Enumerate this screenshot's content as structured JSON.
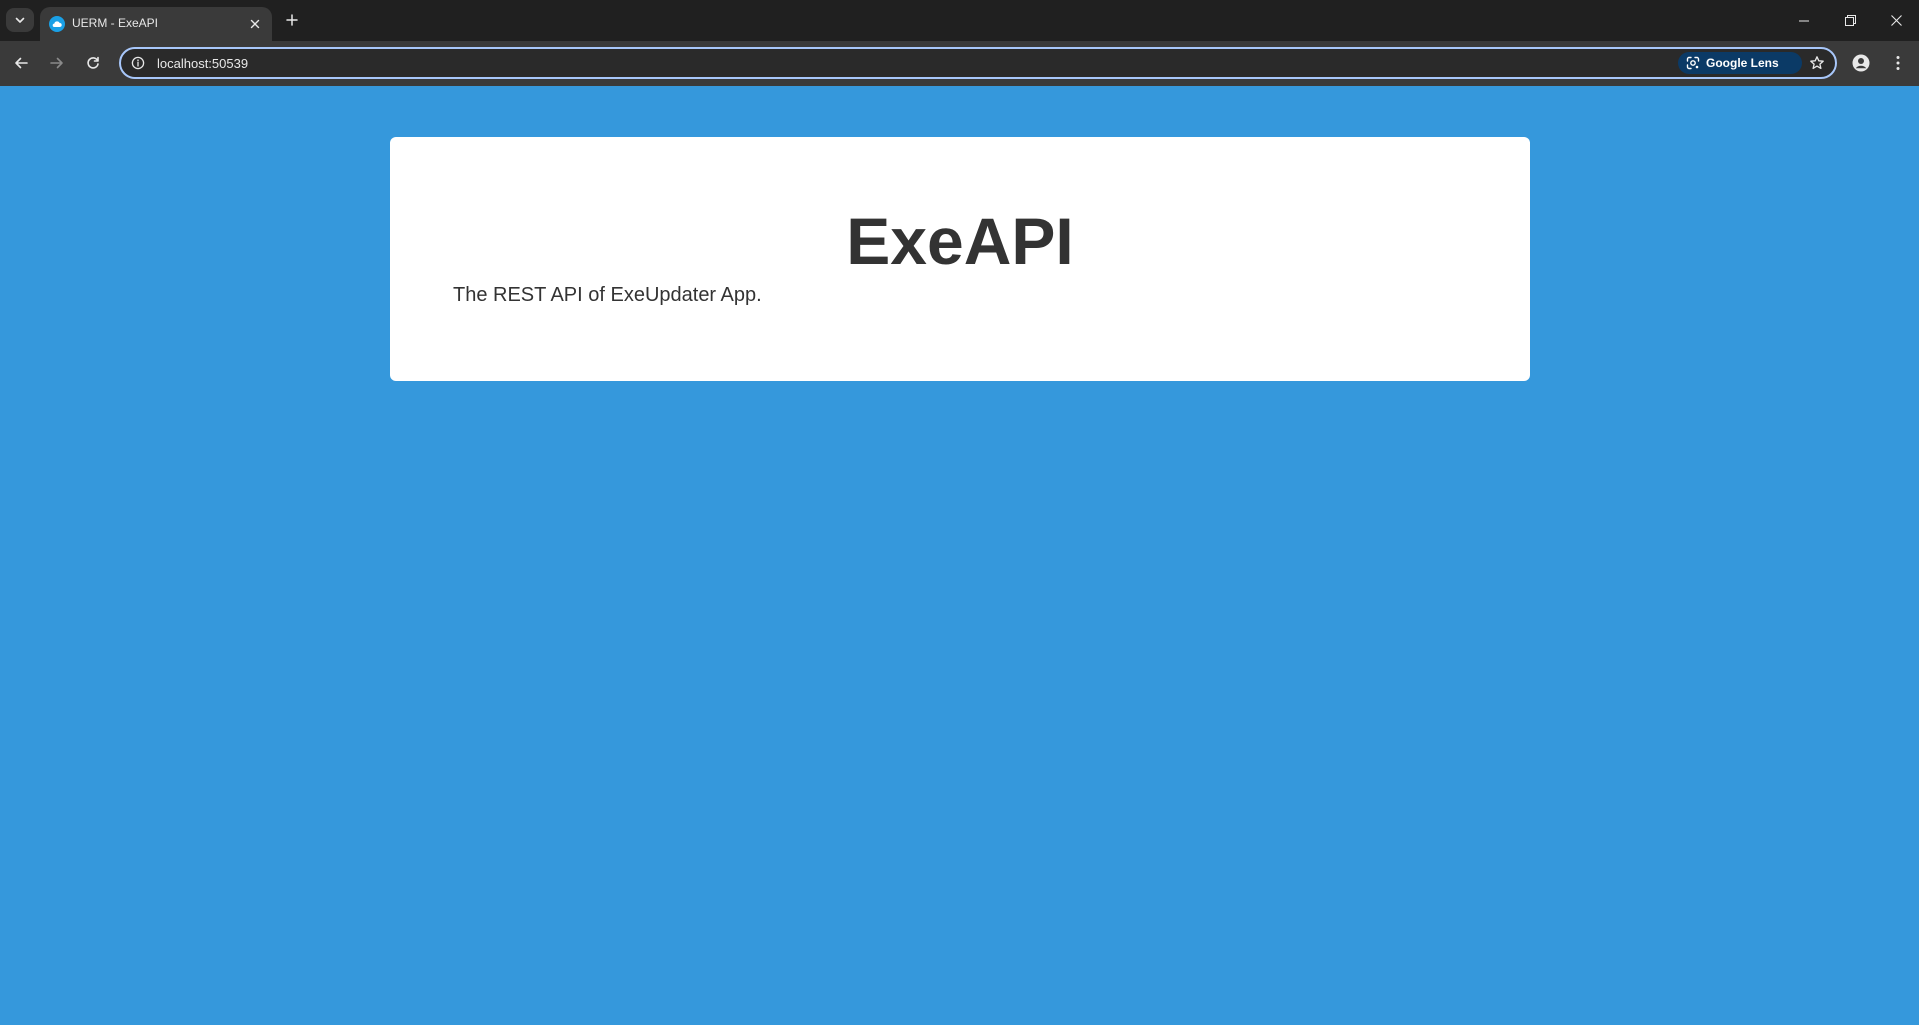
{
  "browser": {
    "tab": {
      "title": "UERM - ExeAPI",
      "favicon": "cloud-icon"
    },
    "address_bar": {
      "url": "localhost:50539"
    },
    "lens_chip": {
      "label": "Google Lens"
    },
    "colors": {
      "tabstrip_bg": "#202020",
      "toolbar_bg": "#3a3a3a",
      "omnibox_focus": "#a8c7fa",
      "lens_chip_bg": "#0b3a66"
    }
  },
  "page": {
    "background_color": "#3598dc",
    "title": "ExeAPI",
    "description": "The REST API of ExeUpdater App."
  }
}
